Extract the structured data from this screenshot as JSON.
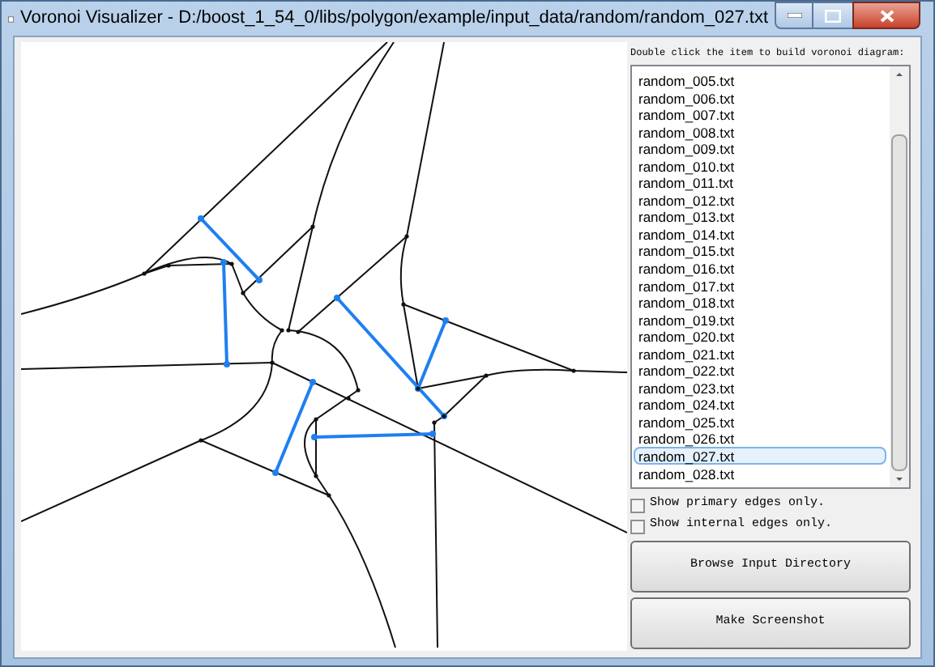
{
  "window": {
    "title": "Voronoi Visualizer - D:/boost_1_54_0/libs/polygon/example/input_data/random/random_027.txt"
  },
  "instruction": "Double click the item to build voronoi diagram:",
  "files": [
    {
      "label": "random_005.txt",
      "selected": false
    },
    {
      "label": "random_006.txt",
      "selected": false
    },
    {
      "label": "random_007.txt",
      "selected": false
    },
    {
      "label": "random_008.txt",
      "selected": false
    },
    {
      "label": "random_009.txt",
      "selected": false
    },
    {
      "label": "random_010.txt",
      "selected": false
    },
    {
      "label": "random_011.txt",
      "selected": false
    },
    {
      "label": "random_012.txt",
      "selected": false
    },
    {
      "label": "random_013.txt",
      "selected": false
    },
    {
      "label": "random_014.txt",
      "selected": false
    },
    {
      "label": "random_015.txt",
      "selected": false
    },
    {
      "label": "random_016.txt",
      "selected": false
    },
    {
      "label": "random_017.txt",
      "selected": false
    },
    {
      "label": "random_018.txt",
      "selected": false
    },
    {
      "label": "random_019.txt",
      "selected": false
    },
    {
      "label": "random_020.txt",
      "selected": false
    },
    {
      "label": "random_021.txt",
      "selected": false
    },
    {
      "label": "random_022.txt",
      "selected": false
    },
    {
      "label": "random_023.txt",
      "selected": false
    },
    {
      "label": "random_024.txt",
      "selected": false
    },
    {
      "label": "random_025.txt",
      "selected": false
    },
    {
      "label": "random_026.txt",
      "selected": false
    },
    {
      "label": "random_027.txt",
      "selected": true
    },
    {
      "label": "random_028.txt",
      "selected": false
    }
  ],
  "options": [
    {
      "label": "Show primary edges only.",
      "checked": false
    },
    {
      "label": "Show internal edges only.",
      "checked": false
    }
  ],
  "buttons": [
    "Browse Input Directory",
    "Make Screenshot"
  ]
}
